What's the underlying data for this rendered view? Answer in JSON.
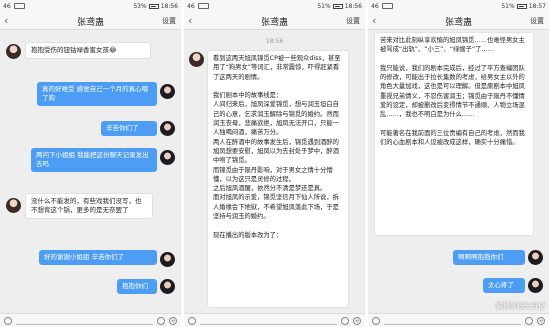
{
  "phones": [
    {
      "status": {
        "carrier": "46",
        "battery": "53%",
        "time": "18:56"
      },
      "header": {
        "title": "张鸢蛊",
        "settings": "设置"
      },
      "messages": {
        "m1": "抱抱受伤的钮钴禄香蜜女孩😂",
        "m2": "真的好难受 感觉自己一个月的真心喂了狗",
        "m3": "辛苦你们了",
        "m4": "两问下小姐姐 我能把这份聊天记录发出去吗",
        "m5": "没什么不能发的，有些戏我们没写，也不想背这个锅，更多的是无奈罢了",
        "m6": "好的谢谢小姐姐 辛苦你们了",
        "m7": "抱抱你们"
      }
    },
    {
      "status": {
        "carrier": "46",
        "battery": "51%",
        "time": "18:56"
      },
      "header": {
        "title": "张鸢蛊",
        "settings": "设置"
      },
      "timestamp": "18:56",
      "long": "看到这两天旭凤锦觅CP被一些观众diss，甚至用了“狗男女”等词汇，非常震惊，吓得赶紧看了这两天的剧情。\n\n我们剧本中的故事线是：\n人间归来后，旭凤深爱锦觅，想与润玉坦白自己的心意，乞求润玉解除与锦觅的婚约。然而润玉丧母，悲痛欲绝，旭凤无法开口，只能一人独喝闷酒，痛苦万分。\n两人在醉酒中的故事发生后，锦觅遇到酒醉的旭凤想要安慰，旭凤以为去封处于梦中，醉酒中吻了锦觅。\n而锦觅由于陨丹影响，对于男女之情十分懵懂，以为这只是灵修的过程。\n之后旭凤酒醒，依然分不清是梦还是真。\n面对旭凤的示爱，锦觅坚信月下仙人所说，拆人婚缘会下地狱，不希望旭凤落此下场，于是坚持与润玉的婚约。\n\n现在播出的版本改为了："
    },
    {
      "status": {
        "carrier": "46",
        "battery": "51%",
        "time": "18:57"
      },
      "header": {
        "title": "张鸢蛊",
        "settings": "设置"
      },
      "long": "苦来对比此刻纵享欢愉的旭凤锦觅……也难怪男女主被骂成“出轨”、“小三”、“绿嫂子”了……\n\n我只能说，我们的剧本完成后，经过了平方查编团队的修改，可能出于拉长集数的考虑，给男女主以外的角色大量加戏，这也是可以理解。但是原剧本中旭凤重视兄弟情义，不忍伤害润玉；锦觅由于陨丹不懂情爱的设定，却被删改后变得情节不通顺、人物立场混乱……，我也不明白是为什么……\n\n可能著名在我前面的三位责编有自己的考虑，然而我们的心血剧本和人设被改成这样，确实十分痛惜。",
      "m1": "啊啊啊抱抱你们",
      "m2": "太心疼了",
      "watermark": "微博@粉头日记"
    }
  ]
}
